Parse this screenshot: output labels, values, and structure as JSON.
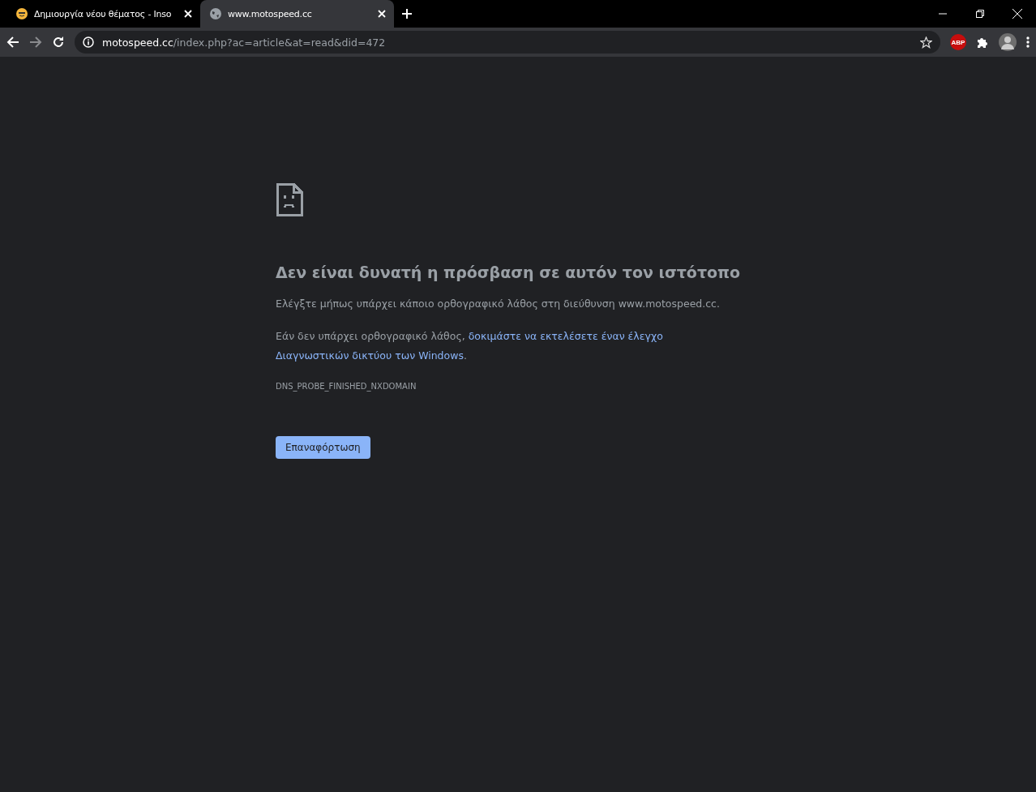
{
  "tabs": [
    {
      "title": "Δημιουργία νέου θέματος - Inso",
      "kind": "forum",
      "selected": false
    },
    {
      "title": "www.motospeed.cc",
      "kind": "globe",
      "selected": true
    }
  ],
  "address_bar": {
    "host": "motospeed.cc",
    "path": "/index.php?ac=article&at=read&did=472"
  },
  "extensions": [
    {
      "kind": "abp",
      "label": "ABP"
    },
    {
      "kind": "puzzle"
    },
    {
      "kind": "avatar"
    }
  ],
  "error": {
    "title": "Δεν είναι δυνατή η πρόσβαση σε αυτόν τον ιστότοπο",
    "check_text": "Ελέγξτε μήπως υπάρχει κάποιο ορθογραφικό λάθος στη διεύθυνση www.motospeed.cc.",
    "suggestion_text": "Εάν δεν υπάρχει ορθογραφικό λάθος,",
    "suggestion_links": [
      "δοκιμάστε να εκτελέσετε έναν έλεγχο",
      "Διαγνωστικών δικτύου των Windows"
    ],
    "suggestion_end": ".",
    "code": "DNS_PROBE_FINISHED_NXDOMAIN",
    "reload_button": "Επαναφόρτωση"
  }
}
